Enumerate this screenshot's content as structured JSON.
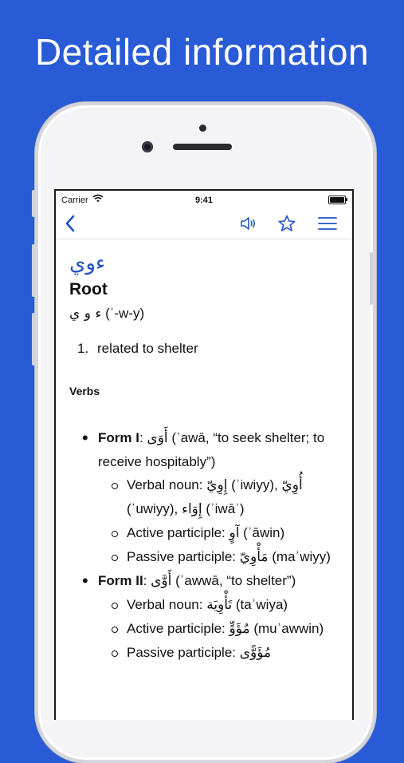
{
  "headline": "Detailed information",
  "status": {
    "carrier": "Carrier",
    "time": "9:41"
  },
  "nav": {
    "back_icon": "chevron-left-icon",
    "speaker_icon": "speaker-icon",
    "star_icon": "star-icon",
    "menu_icon": "menu-icon"
  },
  "entry": {
    "arabic": "ءوي",
    "type": "Root",
    "root_arabic": "ء و ي",
    "root_translit": "(ʾ-w-y)",
    "definition_num": "1.",
    "definition": "related to shelter",
    "section": "Verbs",
    "forms": [
      {
        "label": "Form I",
        "ar": "أَوَى",
        "rest": " (ʾawā, “to seek shelter; to receive hospitably”)",
        "items": [
          {
            "label": "Verbal noun: ",
            "ar": "إِوِيّ",
            "t1": " (ʾiwiyy), ",
            "ar2": "أُوِيّ",
            "t2": " (ʾuwiyy), ",
            "ar3": "إِوَاء",
            "t3": " (ʾiwāʾ)"
          },
          {
            "label": "Active participle: ",
            "ar": "آوٍ",
            "t1": " (ʾāwin)"
          },
          {
            "label": "Passive participle: ",
            "ar": "مَأْوِيّ",
            "t1": " (maʾwiyy)"
          }
        ]
      },
      {
        "label": "Form II",
        "ar": "أَوَّى",
        "rest": " (ʾawwā, “to shelter”)",
        "items": [
          {
            "label": "Verbal noun: ",
            "ar": "تَأْوِيَة",
            "t1": " (taʾwiya)"
          },
          {
            "label": "Active participle: ",
            "ar": "مُؤَوٍّ",
            "t1": " (muʾawwin)"
          },
          {
            "label": "Passive participle: ",
            "ar": "مُؤَوًّى",
            "t1": ""
          }
        ]
      }
    ]
  }
}
